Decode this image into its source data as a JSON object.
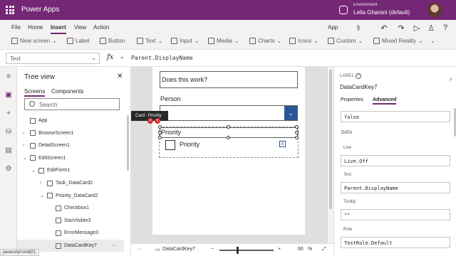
{
  "app": {
    "name": "Power Apps",
    "environment_label": "Environment",
    "environment_name": "Leila Gharani (default)"
  },
  "menu": {
    "items": [
      "File",
      "Home",
      "Insert",
      "View",
      "Action"
    ],
    "active": "Insert",
    "right": [
      "App"
    ]
  },
  "ribbon": {
    "new_screen": "New screen",
    "label": "Label",
    "button": "Button",
    "text": "Text",
    "input": "Input",
    "media": "Media",
    "charts": "Charts",
    "icons": "Icons",
    "custom": "Custom",
    "mixed_reality": "Mixed Reality"
  },
  "formula_bar": {
    "property": "Text",
    "fx": "fx",
    "formula": "Parent.DisplayName"
  },
  "tree": {
    "title": "Tree view",
    "tabs": [
      "Screens",
      "Components"
    ],
    "search_placeholder": "Search",
    "nodes": [
      {
        "label": "App",
        "indent": 0,
        "arrow": ""
      },
      {
        "label": "BrowseScreen1",
        "indent": 0,
        "arrow": "›"
      },
      {
        "label": "DetailScreen1",
        "indent": 0,
        "arrow": "›"
      },
      {
        "label": "EditScreen1",
        "indent": 0,
        "arrow": "⌄"
      },
      {
        "label": "EditForm1",
        "indent": 1,
        "arrow": "⌄"
      },
      {
        "label": "Task_DataCard2",
        "indent": 2,
        "arrow": "›"
      },
      {
        "label": "Priority_DataCard2",
        "indent": 2,
        "arrow": "⌄"
      },
      {
        "label": "Checkbox1",
        "indent": 3,
        "arrow": ""
      },
      {
        "label": "StarVisible3",
        "indent": 3,
        "arrow": ""
      },
      {
        "label": "ErrorMessage3",
        "indent": 3,
        "arrow": ""
      },
      {
        "label": "DataCardKey7",
        "indent": 3,
        "arrow": "",
        "selected": true,
        "more": "···"
      }
    ]
  },
  "canvas": {
    "question": "Does this work?",
    "person_label": "Person",
    "tooltip": "Card : Priority",
    "priority_label": "Priority",
    "checkbox_label": "Priority",
    "badge": "A"
  },
  "status": {
    "more": "···",
    "selected": "DataCardKey7",
    "minus": "−",
    "plus": "+",
    "zoom": "60",
    "unit": "%"
  },
  "browser_status": "javascript:void(0);",
  "props": {
    "type": "LABEL",
    "name": "DataCardKey7",
    "tabs": [
      "Properties",
      "Advanced"
    ],
    "active_tab": "Advanced",
    "top_value": "false",
    "section": "DATA",
    "fields": [
      {
        "label": "Live",
        "value": "Live.Off"
      },
      {
        "label": "Text",
        "value": "Parent.DisplayName"
      },
      {
        "label": "Tooltip",
        "value": "\"\""
      },
      {
        "label": "Role",
        "value": "TextRole.Default"
      }
    ]
  },
  "colors": {
    "brand": "#742774",
    "accent": "#2b5797",
    "error": "#d13438"
  }
}
